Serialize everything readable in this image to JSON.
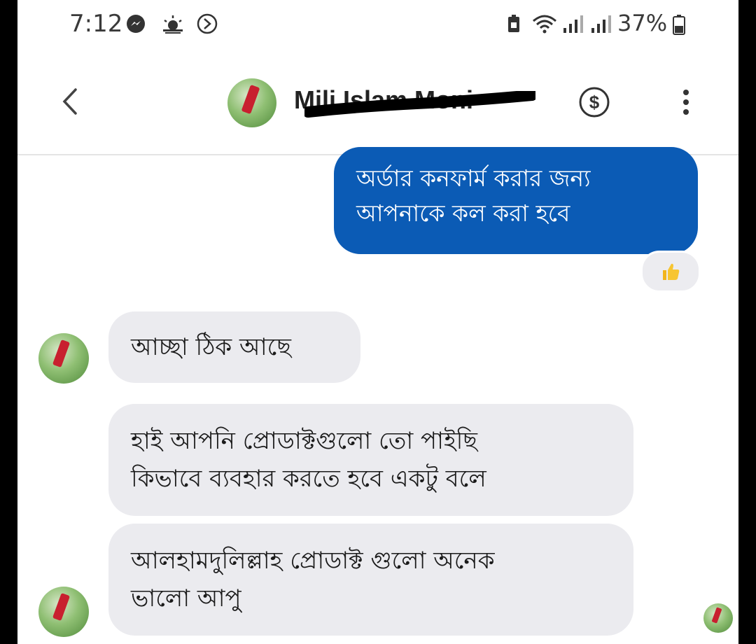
{
  "status_bar": {
    "time": "7:12",
    "battery": "37%",
    "icons": [
      "messenger-icon",
      "weather-icon",
      "sync-icon",
      "battery-saver-icon",
      "wifi-icon",
      "signal-icon",
      "signal-icon",
      "battery-icon"
    ]
  },
  "header": {
    "contact_name": "Mili Islam Moni",
    "icons": [
      "back-icon",
      "dollar-icon",
      "more-options-icon"
    ]
  },
  "messages": [
    {
      "direction": "outgoing",
      "lines": [
        "অর্ডার কনফার্ম করার জন্য",
        "আপনাকে কল করা হবে"
      ],
      "reaction": "thumbs-up"
    },
    {
      "direction": "incoming",
      "lines": [
        "আচ্ছা ঠিক আছে"
      ]
    },
    {
      "direction": "incoming",
      "lines": [
        "হাই আপনি প্রোডাক্টগুলো তো পাইছি",
        "কিভাবে ব্যবহার করতে হবে একটু বলে"
      ]
    },
    {
      "direction": "incoming",
      "lines": [
        "আলহামদুলিল্লাহ প্রোডাক্ট গুলো অনেক",
        "ভালো আপু"
      ]
    }
  ],
  "colors": {
    "outgoing_bubble": "#0b5bb5",
    "incoming_bubble": "#ebebef",
    "background": "#ffffff"
  }
}
